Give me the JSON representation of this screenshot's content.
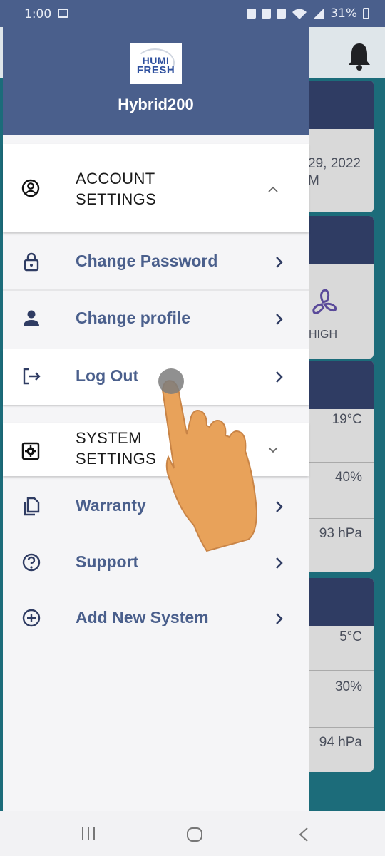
{
  "status_bar": {
    "time": "1:00",
    "battery": "31%"
  },
  "drawer": {
    "logo_line1": "HUMI",
    "logo_line2": "FRESH",
    "device_name": "Hybrid200",
    "account_section": {
      "title_line1": "ACCOUNT",
      "title_line2": "SETTINGS",
      "items": [
        {
          "label": "Change Password",
          "icon": "lock-icon"
        },
        {
          "label": "Change profile",
          "icon": "person-icon"
        },
        {
          "label": "Log Out",
          "icon": "logout-icon"
        }
      ]
    },
    "system_section": {
      "title_line1": "SYSTEM",
      "title_line2": "SETTINGS",
      "items": [
        {
          "label": "Warranty",
          "icon": "copy-icon"
        },
        {
          "label": "Support",
          "icon": "help-icon"
        },
        {
          "label": "Add New System",
          "icon": "add-circle-icon"
        }
      ]
    }
  },
  "background_app": {
    "date_line1": "29, 2022",
    "date_line2": "M",
    "fan_label": "HIGH",
    "group1": {
      "temperature": "19°C",
      "humidity": "40%",
      "pressure": "93 hPa"
    },
    "group2": {
      "temperature": "5°C",
      "humidity": "30%",
      "pressure": "94 hPa"
    }
  },
  "colors": {
    "drawer_header": "#4a5f8c",
    "card_header": "#2f3c63",
    "item_text": "#4a5f8c",
    "background": "#1c6c7a"
  }
}
